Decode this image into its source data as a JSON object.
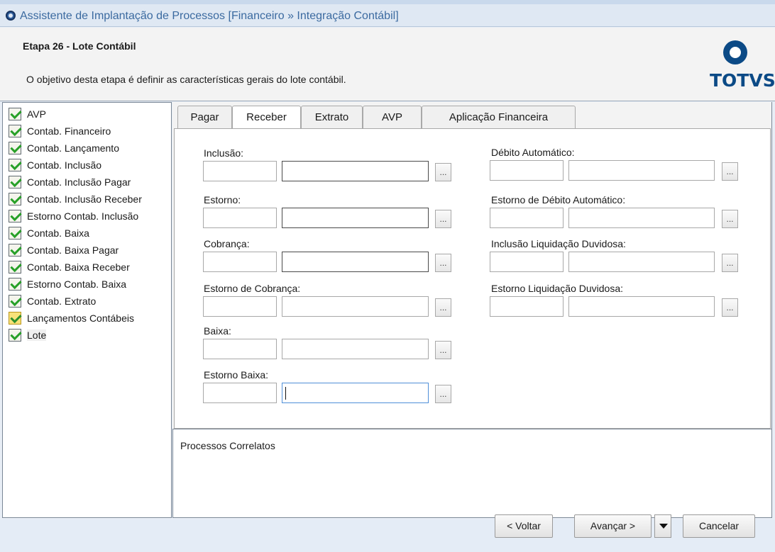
{
  "window": {
    "title": "Assistente de Implantação de Processos [Financeiro » Integração Contábil]"
  },
  "header": {
    "step_title": "Etapa 26 - Lote Contábil",
    "description": "O objetivo desta etapa é definir as características gerais do lote contábil.",
    "logo_text": "TOTVS"
  },
  "tree": {
    "items": [
      {
        "label": "AVP",
        "status": "done"
      },
      {
        "label": "Contab. Financeiro",
        "status": "done"
      },
      {
        "label": "Contab. Lançamento",
        "status": "done"
      },
      {
        "label": "Contab. Inclusão",
        "status": "done"
      },
      {
        "label": "Contab. Inclusão Pagar",
        "status": "done"
      },
      {
        "label": "Contab. Inclusão Receber",
        "status": "done"
      },
      {
        "label": "Estorno Contab. Inclusão",
        "status": "done"
      },
      {
        "label": "Contab. Baixa",
        "status": "done"
      },
      {
        "label": "Contab. Baixa Pagar",
        "status": "done"
      },
      {
        "label": "Contab. Baixa Receber",
        "status": "done"
      },
      {
        "label": "Estorno Contab. Baixa",
        "status": "done"
      },
      {
        "label": "Contab. Extrato",
        "status": "done"
      },
      {
        "label": "Lançamentos Contábeis",
        "status": "warning"
      },
      {
        "label": "Lote",
        "status": "done",
        "selected": true
      }
    ]
  },
  "tabs": [
    {
      "label": "Pagar"
    },
    {
      "label": "Receber",
      "active": true
    },
    {
      "label": "Extrato"
    },
    {
      "label": "AVP"
    },
    {
      "label": "Aplicação Financeira"
    }
  ],
  "form": {
    "left": [
      {
        "label": "Inclusão:",
        "code": "",
        "description": "",
        "lookup": "..."
      },
      {
        "label": "Estorno:",
        "code": "",
        "description": "",
        "lookup": "..."
      },
      {
        "label": "Cobrança:",
        "code": "",
        "description": "",
        "lookup": "..."
      },
      {
        "label": "Estorno de Cobrança:",
        "code": "",
        "description": "",
        "lookup": "..."
      },
      {
        "label": "Baixa:",
        "code": "",
        "description": "",
        "lookup": "..."
      },
      {
        "label": "Estorno Baixa:",
        "code": "",
        "description": "",
        "lookup": "..."
      }
    ],
    "right": [
      {
        "label": "Débito Automático:",
        "code": "",
        "description": "",
        "lookup": "..."
      },
      {
        "label": "Estorno de Débito Automático:",
        "code": "",
        "description": "",
        "lookup": "..."
      },
      {
        "label": "Inclusão Liquidação Duvidosa:",
        "code": "",
        "description": "",
        "lookup": "..."
      },
      {
        "label": "Estorno Liquidação Duvidosa:",
        "code": "",
        "description": "",
        "lookup": "..."
      }
    ]
  },
  "correlatos": {
    "label": "Processos Correlatos"
  },
  "footer": {
    "back_label": "< Voltar",
    "next_label": "Avançar >",
    "cancel_label": "Cancelar"
  }
}
